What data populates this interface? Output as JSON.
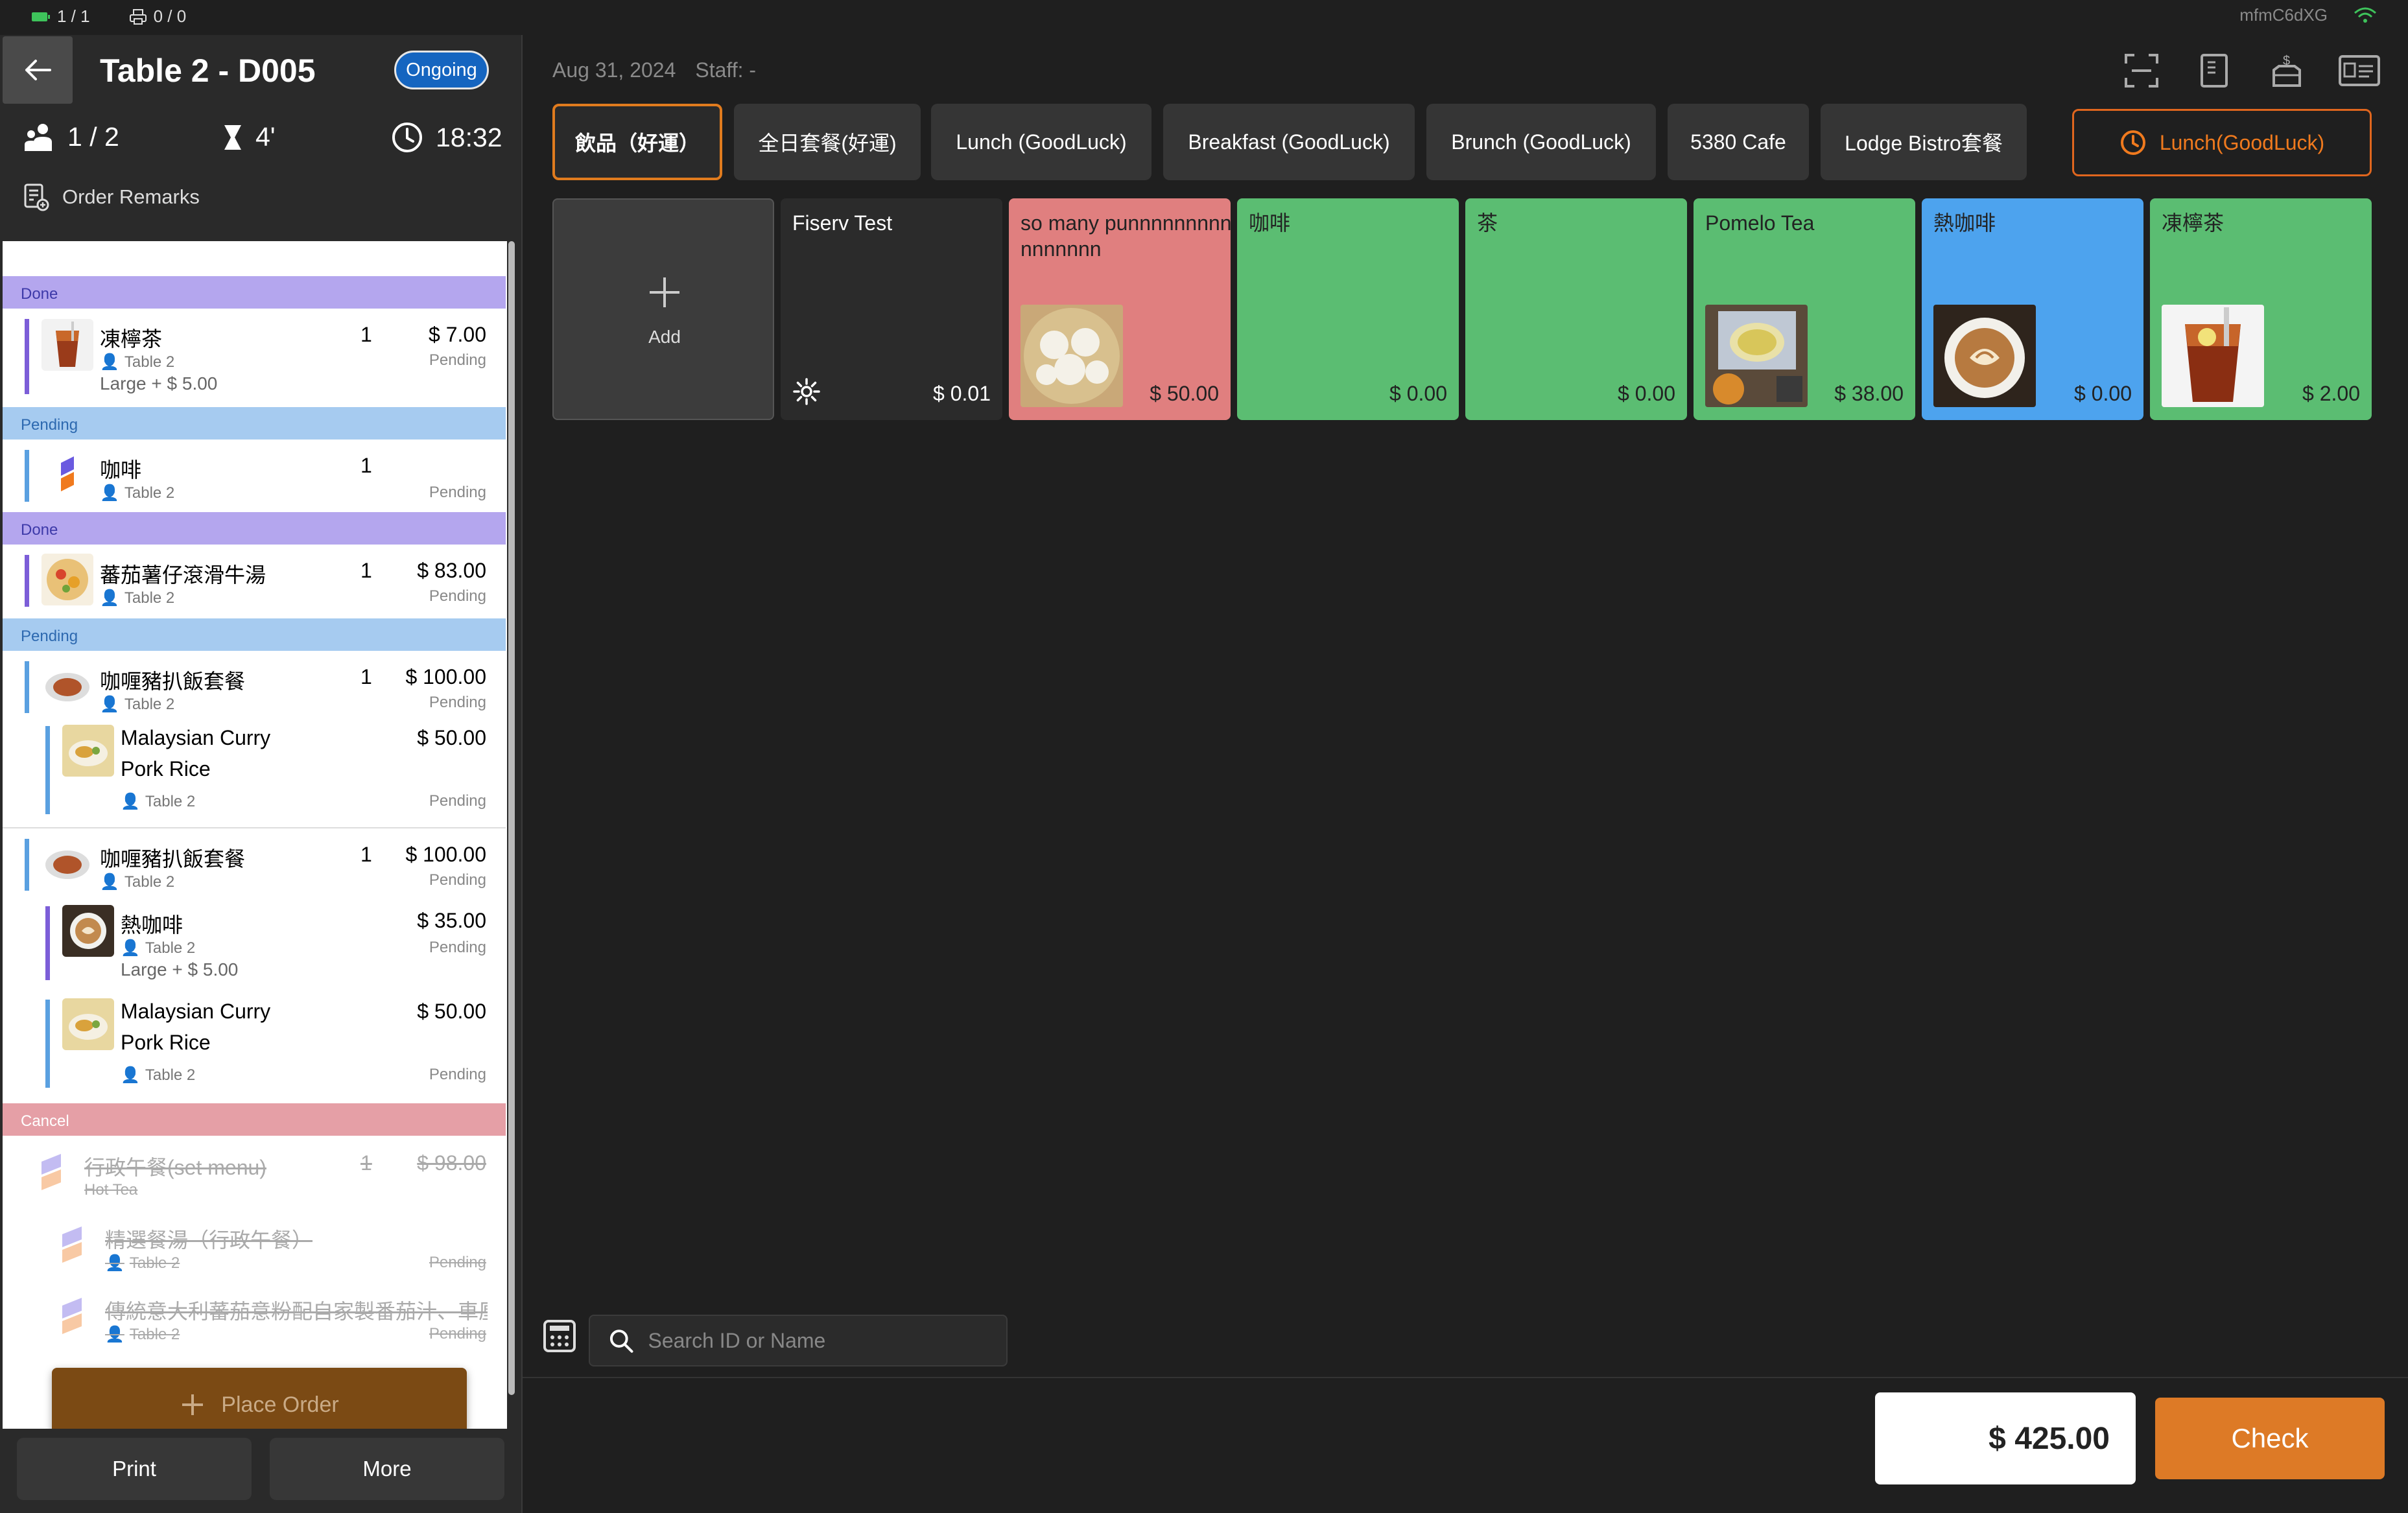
{
  "status_bar": {
    "batteries": "1 / 1",
    "printers": "0 / 0",
    "device_id": "mfmC6dXG"
  },
  "header": {
    "title": "Table 2 - D005",
    "status": "Ongoing"
  },
  "stats": {
    "guests": "1 / 2",
    "duration": "4'",
    "time": "18:32"
  },
  "remarks_label": "Order Remarks",
  "orders": {
    "s1": "Done",
    "i1": {
      "name": "凍檸茶",
      "table": "Table 2",
      "qty": "1",
      "price": "$ 7.00",
      "status": "Pending",
      "extra": "Large  + $ 5.00"
    },
    "s2": "Pending",
    "i2": {
      "name": "咖啡",
      "table": "Table 2",
      "qty": "1",
      "status": "Pending"
    },
    "s3": "Done",
    "i3": {
      "name": "蕃茄薯仔滾滑牛湯",
      "table": "Table 2",
      "qty": "1",
      "price": "$ 83.00",
      "status": "Pending"
    },
    "s4": "Pending",
    "i4": {
      "name": "咖喱豬扒飯套餐",
      "table": "Table 2",
      "qty": "1",
      "price": "$ 100.00",
      "status": "Pending"
    },
    "i4a": {
      "name": "Malaysian Curry Pork Rice",
      "table": "Table 2",
      "price": "$ 50.00",
      "status": "Pending"
    },
    "i5": {
      "name": "咖喱豬扒飯套餐",
      "table": "Table 2",
      "qty": "1",
      "price": "$ 100.00",
      "status": "Pending"
    },
    "i5a": {
      "name": "熱咖啡",
      "table": "Table 2",
      "price": "$ 35.00",
      "status": "Pending",
      "extra": "Large  + $ 5.00"
    },
    "i5b": {
      "name": "Malaysian Curry Pork Rice",
      "table": "Table 2",
      "price": "$ 50.00",
      "status": "Pending"
    },
    "s5": "Cancel",
    "i6": {
      "name": "行政午餐(set menu)",
      "sub": "Hot Tea",
      "qty": "1",
      "price": "$ 98.00"
    },
    "i6a": {
      "name": "精選餐湯（行政午餐）",
      "table": "Table 2",
      "status": "Pending"
    },
    "i6b": {
      "name": "傳統意大利蕃茄意粉配自家製番茄汁、車厘茄",
      "table": "Table 2",
      "status": "Pending"
    }
  },
  "place_order": "Place Order",
  "footer": {
    "print": "Print",
    "more": "More"
  },
  "right_header": {
    "date": "Aug 31, 2024",
    "staff": "Staff: -"
  },
  "categories": [
    "飲品（好運）",
    "全日套餐(好運)",
    "Lunch (GoodLuck)",
    "Breakfast (GoodLuck)",
    "Brunch (GoodLuck)",
    "5380 Cafe",
    "Lodge Bistro套餐"
  ],
  "menu_button": "Lunch(GoodLuck)",
  "add_tile": "Add",
  "products": [
    {
      "name": "Fiserv Test",
      "price": "$ 0.01",
      "color": "#2b2b2b"
    },
    {
      "name": "so many punnnnnnnnnnnnnnnn",
      "price": "$ 50.00",
      "color": "#e07f7f"
    },
    {
      "name": "咖啡",
      "price": "$ 0.00",
      "color": "#5bbd72"
    },
    {
      "name": "茶",
      "price": "$ 0.00",
      "color": "#5bbd72"
    },
    {
      "name": "Pomelo Tea",
      "price": "$ 38.00",
      "color": "#5bbd72"
    },
    {
      "name": "熱咖啡",
      "price": "$ 0.00",
      "color": "#4da3ee"
    },
    {
      "name": "凍檸茶",
      "price": "$ 2.00",
      "color": "#5bbd72"
    }
  ],
  "search": {
    "placeholder": "Search ID or Name"
  },
  "total": "$ 425.00",
  "check": "Check"
}
